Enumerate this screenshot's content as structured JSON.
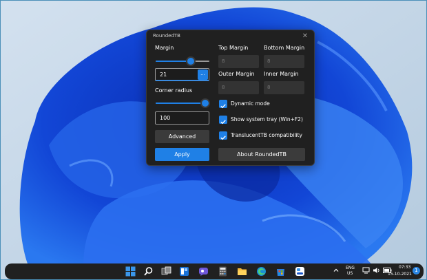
{
  "window": {
    "title": "RoundedTB",
    "close_glyph": "✕"
  },
  "margin": {
    "label": "Margin",
    "slider_fraction": 0.66,
    "value": "21",
    "browse_label": "..."
  },
  "corner_radius": {
    "label": "Corner radius",
    "slider_fraction": 0.92,
    "value": "100"
  },
  "buttons": {
    "advanced": "Advanced",
    "apply": "Apply",
    "about": "About RoundedTB"
  },
  "margins": {
    "top_label": "Top Margin",
    "top_value": "8",
    "bottom_label": "Bottom Margin",
    "bottom_value": "8",
    "outer_label": "Outer Margin",
    "outer_value": "8",
    "inner_label": "Inner Margin",
    "inner_value": "8"
  },
  "options": {
    "dynamic_mode": "Dynamic mode",
    "system_tray": "Show system tray (Win+F2)",
    "translucenttb": "TranslucentTB compatibility"
  },
  "taskbar": {
    "lang_top": "ENG",
    "lang_bottom": "US",
    "time": "07:33",
    "date": "15-10-2021",
    "notification_count": "1"
  },
  "colors": {
    "accent": "#1f80e6",
    "window_bg": "#202020",
    "taskbar_bg": "#202020"
  },
  "icons": {
    "start": "windows-start-icon",
    "search": "search-icon",
    "task_view": "task-view-icon",
    "widgets": "widgets-icon",
    "chat": "teams-chat-icon",
    "calculator": "calculator-icon",
    "explorer": "file-explorer-icon",
    "edge": "edge-browser-icon",
    "store": "store-icon",
    "rounded_tb": "roundedtb-app-icon"
  }
}
